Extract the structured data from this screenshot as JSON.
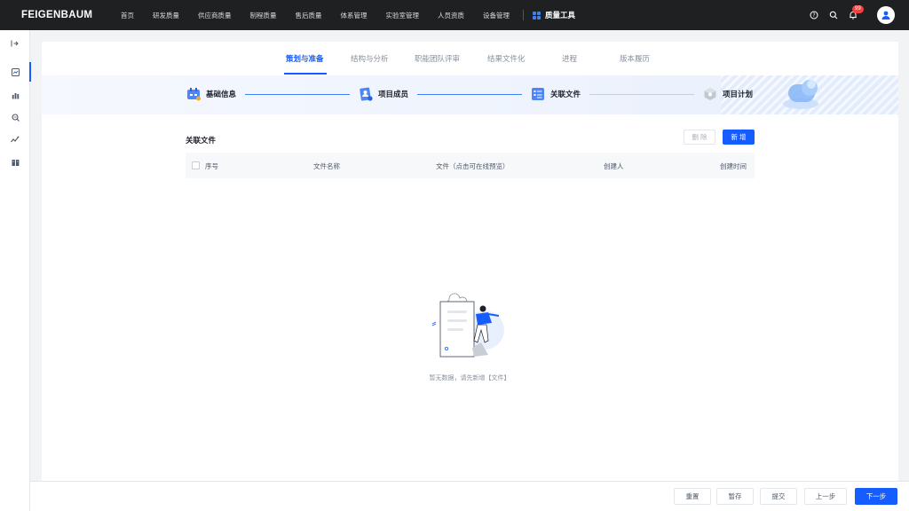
{
  "app": {
    "logo": "FEIGENBAUM"
  },
  "topnav": {
    "items": [
      "首页",
      "研发质量",
      "供应商质量",
      "制程质量",
      "售后质量",
      "体系管理",
      "实验室管理",
      "人员资质",
      "设备管理"
    ],
    "active": "质量工具",
    "notification_count": "99"
  },
  "tabs": [
    {
      "label": "策划与准备",
      "active": true
    },
    {
      "label": "结构与分析",
      "active": false
    },
    {
      "label": "职能团队评审",
      "active": false
    },
    {
      "label": "结果文件化",
      "active": false
    },
    {
      "label": "进程",
      "active": false
    },
    {
      "label": "版本履历",
      "active": false
    }
  ],
  "steps": [
    {
      "label": "基础信息"
    },
    {
      "label": "项目成员"
    },
    {
      "label": "关联文件"
    },
    {
      "label": "项目计划"
    }
  ],
  "section": {
    "title": "关联文件",
    "delete_label": "删 除",
    "add_label": "新 增"
  },
  "table": {
    "columns": [
      "序号",
      "文件名称",
      "文件（点击可在线预览）",
      "创建人",
      "创建时间"
    ],
    "empty_text": "暂无数据，请先新增【文件】"
  },
  "footer": {
    "reset": "重置",
    "save_draft": "暂存",
    "submit": "提交",
    "prev": "上一步",
    "next": "下一步"
  },
  "colors": {
    "primary": "#165dff",
    "topbar": "#1f2022"
  }
}
